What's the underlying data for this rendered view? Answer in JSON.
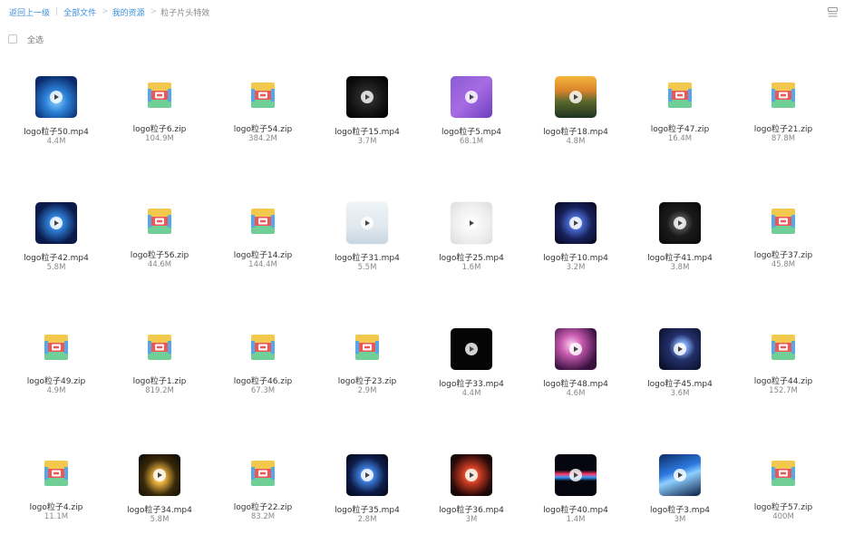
{
  "breadcrumb": {
    "back": "返回上一级",
    "all_files": "全部文件",
    "my_resources": "我的资源",
    "current": "粒子片头特效",
    "separator": "|",
    "arrow": ">"
  },
  "toolbar": {
    "view_icon": "list-view-icon"
  },
  "selection": {
    "select_all_label": "全选"
  },
  "files": [
    {
      "name": "logo粒子50.mp4",
      "size": "4.4M",
      "type": "video",
      "thumb": "blue-text"
    },
    {
      "name": "logo粒子6.zip",
      "size": "104.9M",
      "type": "zip"
    },
    {
      "name": "logo粒子54.zip",
      "size": "384.2M",
      "type": "zip"
    },
    {
      "name": "logo粒子15.mp4",
      "size": "3.7M",
      "type": "video",
      "thumb": "dark-ring"
    },
    {
      "name": "logo粒子5.mp4",
      "size": "68.1M",
      "type": "video",
      "thumb": "purple"
    },
    {
      "name": "logo粒子18.mp4",
      "size": "4.8M",
      "type": "video",
      "thumb": "sunset"
    },
    {
      "name": "logo粒子47.zip",
      "size": "16.4M",
      "type": "zip"
    },
    {
      "name": "logo粒子21.zip",
      "size": "87.8M",
      "type": "zip"
    },
    {
      "name": "logo粒子42.mp4",
      "size": "5.8M",
      "type": "video",
      "thumb": "lightning"
    },
    {
      "name": "logo粒子56.zip",
      "size": "44.6M",
      "type": "zip"
    },
    {
      "name": "logo粒子14.zip",
      "size": "144.4M",
      "type": "zip"
    },
    {
      "name": "logo粒子31.mp4",
      "size": "5.5M",
      "type": "video",
      "thumb": "white-particles"
    },
    {
      "name": "logo粒子25.mp4",
      "size": "1.6M",
      "type": "video",
      "thumb": "white-light"
    },
    {
      "name": "logo粒子10.mp4",
      "size": "3.2M",
      "type": "video",
      "thumb": "blue-burst"
    },
    {
      "name": "logo粒子41.mp4",
      "size": "3.8M",
      "type": "video",
      "thumb": "dark-glow"
    },
    {
      "name": "logo粒子37.zip",
      "size": "45.8M",
      "type": "zip"
    },
    {
      "name": "logo粒子49.zip",
      "size": "4.9M",
      "type": "zip"
    },
    {
      "name": "logo粒子1.zip",
      "size": "819.2M",
      "type": "zip"
    },
    {
      "name": "logo粒子46.zip",
      "size": "67.3M",
      "type": "zip"
    },
    {
      "name": "logo粒子23.zip",
      "size": "2.9M",
      "type": "zip"
    },
    {
      "name": "logo粒子33.mp4",
      "size": "4.4M",
      "type": "video",
      "thumb": "black"
    },
    {
      "name": "logo粒子48.mp4",
      "size": "4.6M",
      "type": "video",
      "thumb": "pink-particles"
    },
    {
      "name": "logo粒子45.mp4",
      "size": "3.6M",
      "type": "video",
      "thumb": "space-text"
    },
    {
      "name": "logo粒子44.zip",
      "size": "152.7M",
      "type": "zip"
    },
    {
      "name": "logo粒子4.zip",
      "size": "11.1M",
      "type": "zip"
    },
    {
      "name": "logo粒子34.mp4",
      "size": "5.8M",
      "type": "video",
      "thumb": "gold-flare"
    },
    {
      "name": "logo粒子22.zip",
      "size": "83.2M",
      "type": "zip"
    },
    {
      "name": "logo粒子35.mp4",
      "size": "2.8M",
      "type": "video",
      "thumb": "blue-electric"
    },
    {
      "name": "logo粒子36.mp4",
      "size": "3M",
      "type": "video",
      "thumb": "red-sparks"
    },
    {
      "name": "logo粒子40.mp4",
      "size": "1.4M",
      "type": "video",
      "thumb": "color-streak"
    },
    {
      "name": "logo粒子3.mp4",
      "size": "3M",
      "type": "video",
      "thumb": "blue-wave"
    },
    {
      "name": "logo粒子57.zip",
      "size": "400M",
      "type": "zip"
    }
  ],
  "colors": {
    "link": "#3b8fd9",
    "zip_top": "#f2c94c",
    "zip_mid": "#eb5757",
    "zip_bottom": "#6fcf97",
    "zip_side": "#56a6e8"
  }
}
